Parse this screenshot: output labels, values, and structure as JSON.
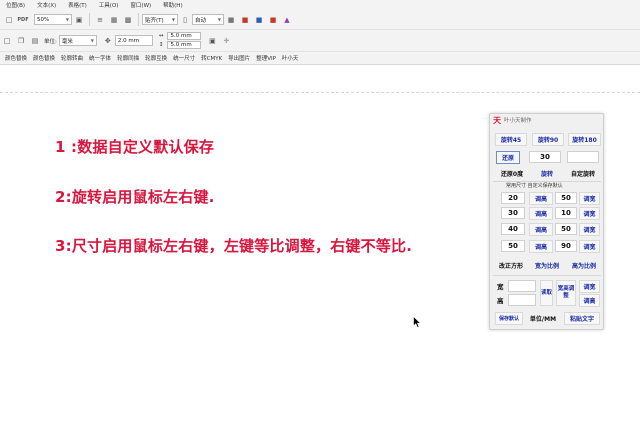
{
  "menu": [
    "位图(B)",
    "文本(X)",
    "表格(T)",
    "工具(O)",
    "窗口(W)",
    "帮助(H)"
  ],
  "toolbar1": {
    "zoom": "50%",
    "paste_mode": "贴齐(T)",
    "auto": "自动"
  },
  "toolbar2": {
    "unit_label": "单位:",
    "unit": "毫米",
    "nudge": "2.0 mm",
    "dup_x": "5.0 mm",
    "dup_y": "5.0 mm"
  },
  "plugin_bar": [
    "颜色替换",
    "颜色替换",
    "轮廓转曲",
    "统一字体",
    "轮廓同描",
    "轮廓互换",
    "统一尺寸",
    "转CMYK",
    "导出图片",
    "整理VIP",
    "叶小天"
  ],
  "notes": [
    "1 :数据自定义默认保存",
    "2:旋转启用鼠标左右键.",
    "3:尺寸启用鼠标左右键，左键等比调整，右键不等比."
  ],
  "panel": {
    "title": "叶小天制作",
    "rotate45": "旋转45",
    "rotate90": "旋转90",
    "rotate180": "旋转180",
    "reset_angle": "还原",
    "angle_value": "30",
    "reset_zero": "还原0度",
    "rotate": "旋转",
    "custom_rotate": "自定旋转",
    "size_caption": "常用尺寸  自定义保存默认",
    "rows": [
      {
        "a": "20",
        "a_btn": "调高",
        "b": "50",
        "b_btn": "调宽"
      },
      {
        "a": "30",
        "a_btn": "调高",
        "b": "10",
        "b_btn": "调宽"
      },
      {
        "a": "40",
        "a_btn": "调高",
        "b": "50",
        "b_btn": "调宽"
      },
      {
        "a": "50",
        "a_btn": "调高",
        "b": "90",
        "b_btn": "调宽"
      }
    ],
    "square": "改正方形",
    "width_ratio": "宽为比例",
    "height_ratio": "高为比例",
    "width_label": "宽",
    "height_label": "高",
    "read": "读取",
    "width_height_adjust": "宽高调整",
    "adjust_width": "调宽",
    "adjust_height": "调高",
    "save_default": "保存默认",
    "unit": "单位/MM",
    "paste_text": "粘贴文字"
  },
  "colors": {
    "accent_red": "#d8163e",
    "panel_blue": "#1a2ca8"
  }
}
